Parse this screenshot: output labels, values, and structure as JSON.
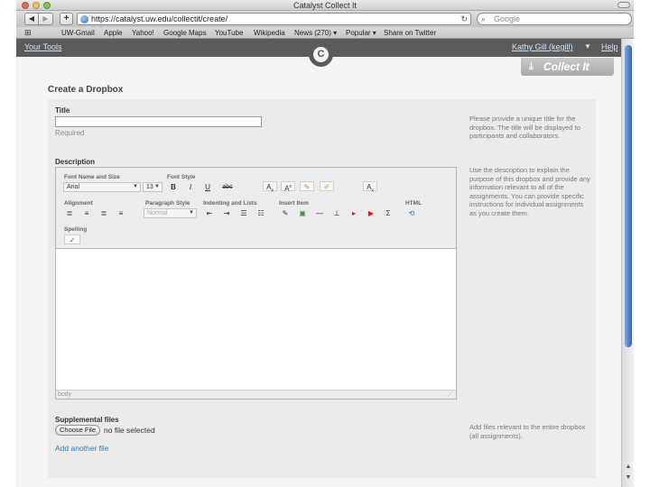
{
  "window": {
    "title": "Catalyst Collect It"
  },
  "toolbar": {
    "url": "https://catalyst.uw.edu/collectit/create/",
    "reload_glyph": "↻",
    "search_placeholder": "Google"
  },
  "bookmarks": [
    "UW-Gmail",
    "Apple",
    "Yahoo!",
    "Google Maps",
    "YouTube",
    "Wikipedia",
    "News (270) ▾",
    "Popular ▾",
    "Share on Twitter"
  ],
  "site": {
    "your_tools": "Your Tools",
    "user": "Kathy Gill (kegill)",
    "help": "Help",
    "logo_letter": "C",
    "collect_it": "Collect It"
  },
  "page": {
    "heading": "Create a Dropbox",
    "title_label": "Title",
    "title_value": "",
    "required": "Required",
    "description_label": "Description",
    "supplemental_label": "Supplemental files",
    "choose_file": "Choose File",
    "no_file": "no file selected",
    "add_another": "Add another file"
  },
  "help": {
    "title": "Please provide a unique title for the dropbox. The title will be displayed to participants and collaborators.",
    "description": "Use the description to explain the purpose of this dropbox and provide any information relevant to all of the assignments. You can provide specific instructions for individual assignments as you create them.",
    "files": "Add files relevant to the entire dropbox (all assignments)."
  },
  "editor": {
    "groups": {
      "font": "Font Name and Size",
      "style": "Font Style",
      "alignment": "Alignment",
      "paragraph": "Paragraph Style",
      "indent": "Indenting and Lists",
      "insert": "Insert Item",
      "html": "HTML",
      "spelling": "Spelling"
    },
    "font_name": "Arial",
    "font_size": "13",
    "paragraph_style": "Normal",
    "buttons": {
      "bold": "B",
      "italic": "I",
      "underline": "U",
      "strike": "abc",
      "sub": "A",
      "sup": "A",
      "clear": "A"
    },
    "status_path": "body"
  },
  "icons": [
    "back-icon",
    "forward-icon",
    "add-tab-icon",
    "globe-icon",
    "reload-icon",
    "search-icon",
    "bookmarks-icon",
    "download-icon",
    "scroll-up-icon",
    "scroll-down-icon"
  ]
}
